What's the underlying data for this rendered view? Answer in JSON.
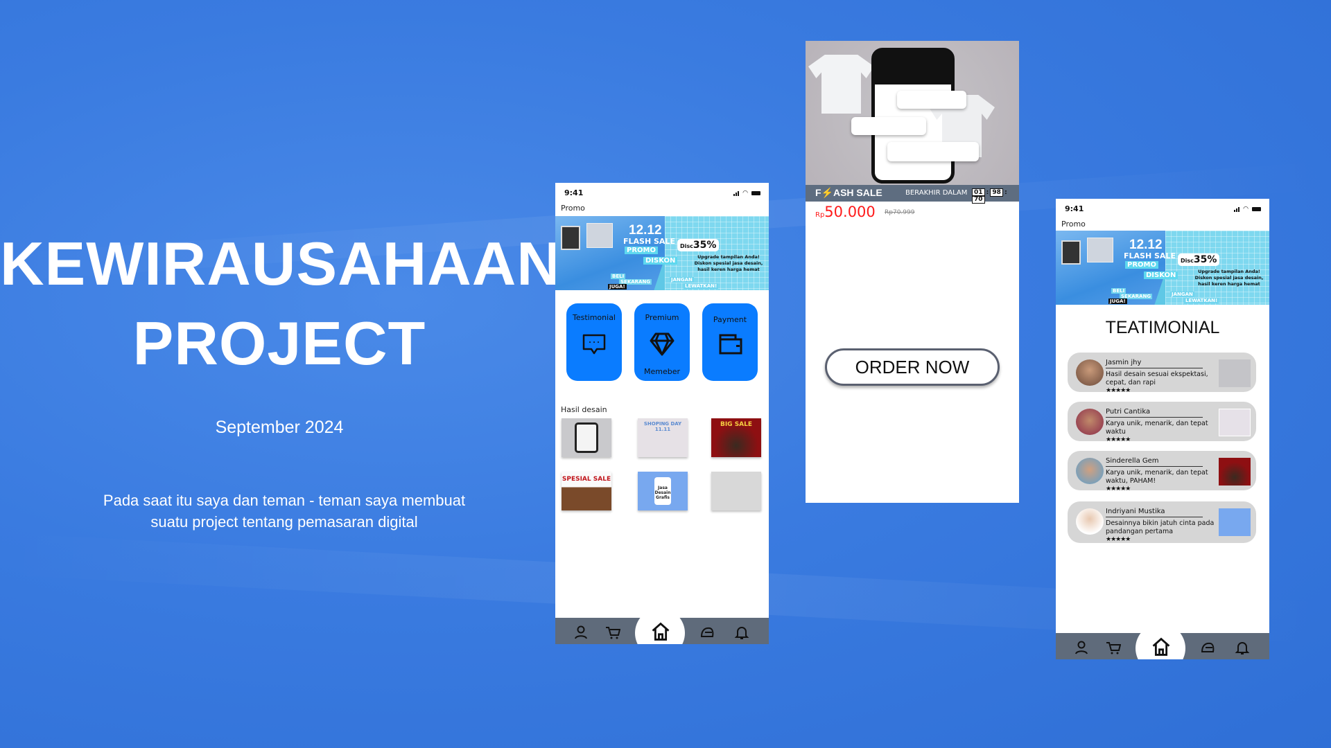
{
  "slide": {
    "title_line1": "KEWIRAUSAHAAN",
    "title_line2": "PROJECT",
    "date": "September 2024",
    "description_line1": "Pada saat itu saya dan teman - teman saya membuat",
    "description_line2": "suatu project tentang pemasaran digital"
  },
  "banner": {
    "date": "12.12",
    "flash": "FLASH SALE",
    "promo": "PROMO",
    "diskon": "DISKON",
    "beli": "BELI",
    "sekarang": "SEKARANG",
    "juga": "JUGA!",
    "disc": "Disc",
    "pct": "35%",
    "text": "Upgrade tampilan Anda! Diskon spesial jasa desain, hasil keren harga hemat",
    "jangan": "JANGAN",
    "lewatkan": "LEWATKAN!"
  },
  "phone1": {
    "time": "9:41",
    "promo_label": "Promo",
    "cards": [
      {
        "label": "Testimonial",
        "icon": "chat-bubble-icon"
      },
      {
        "label": "Premium",
        "sub": "Memeber",
        "icon": "diamond-icon"
      },
      {
        "label": "Payment",
        "icon": "wallet-icon"
      }
    ],
    "section_label": "Hasil desain",
    "thumbs": [
      "",
      "SHOPING DAY 11.11",
      "BIG SALE",
      "SPESIAL SALE",
      "Jasa Desain Grafis",
      ""
    ]
  },
  "phone2": {
    "flash_sale": "F⚡ASH SALE",
    "ends_label": "BERAKHIR  DALAM",
    "countdown": [
      "01",
      "98",
      "70"
    ],
    "currency": "Rp",
    "price": "50.000",
    "old_price": "Rp70.999",
    "order_button": "ORDER NOW"
  },
  "phone3": {
    "time": "9:41",
    "promo_label": "Promo",
    "heading": "TEATIMONIAL",
    "testimonials": [
      {
        "name": "Jasmin jhy",
        "text": "Hasil desain sesuai ekspektasi, cepat, dan rapi",
        "stars": "★★★★★"
      },
      {
        "name": "Putri Cantika",
        "text": "Karya unik, menarik, dan tepat waktu",
        "stars": "★★★★★"
      },
      {
        "name": "Sinderella Gem",
        "text": "Karya unik, menarik, dan tepat waktu, PAHAM!",
        "stars": "★★★★★"
      },
      {
        "name": "Indriyani Mustika",
        "text": "Desainnya bikin jatuh cinta pada pandangan pertama",
        "stars": "★★★★★"
      }
    ]
  },
  "nav": [
    "profile-icon",
    "cart-icon",
    "home-icon",
    "helmet-icon",
    "bell-icon"
  ],
  "colors": {
    "background": "#3a7be0",
    "accent": "#0a7cff",
    "nav": "#5f6b7b",
    "price": "#ff1a1a"
  }
}
